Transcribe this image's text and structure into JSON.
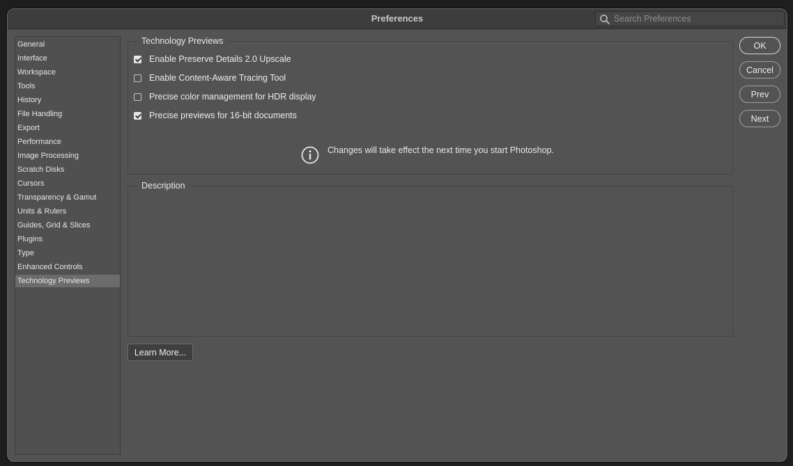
{
  "window": {
    "title": "Preferences"
  },
  "search": {
    "placeholder": "Search Preferences",
    "value": ""
  },
  "sidebar": {
    "items": [
      {
        "label": "General"
      },
      {
        "label": "Interface"
      },
      {
        "label": "Workspace"
      },
      {
        "label": "Tools"
      },
      {
        "label": "History"
      },
      {
        "label": "File Handling"
      },
      {
        "label": "Export"
      },
      {
        "label": "Performance"
      },
      {
        "label": "Image Processing"
      },
      {
        "label": "Scratch Disks"
      },
      {
        "label": "Cursors"
      },
      {
        "label": "Transparency & Gamut"
      },
      {
        "label": "Units & Rulers"
      },
      {
        "label": "Guides, Grid & Slices"
      },
      {
        "label": "Plugins"
      },
      {
        "label": "Type"
      },
      {
        "label": "Enhanced Controls"
      },
      {
        "label": "Technology Previews"
      }
    ],
    "selected": "Technology Previews"
  },
  "technology_previews": {
    "group_label": "Technology Previews",
    "options": [
      {
        "label": "Enable Preserve Details 2.0 Upscale",
        "checked": true
      },
      {
        "label": "Enable Content-Aware Tracing Tool",
        "checked": false
      },
      {
        "label": "Precise color management for HDR display",
        "checked": false
      },
      {
        "label": "Precise previews for 16-bit documents",
        "checked": true
      }
    ],
    "info_text": "Changes will take effect the next time you start Photoshop."
  },
  "description": {
    "group_label": "Description",
    "text": ""
  },
  "learn_more": {
    "label": "Learn More..."
  },
  "buttons": {
    "ok": "OK",
    "cancel": "Cancel",
    "prev": "Prev",
    "next": "Next"
  },
  "icons": {
    "search": "search-icon",
    "info": "info-icon",
    "check": "checkmark-icon"
  },
  "colors": {
    "window_bg": "#535353",
    "titlebar_bg": "#3d3d3d",
    "selected_item_bg": "#6c6c6c",
    "text": "#ececec"
  }
}
